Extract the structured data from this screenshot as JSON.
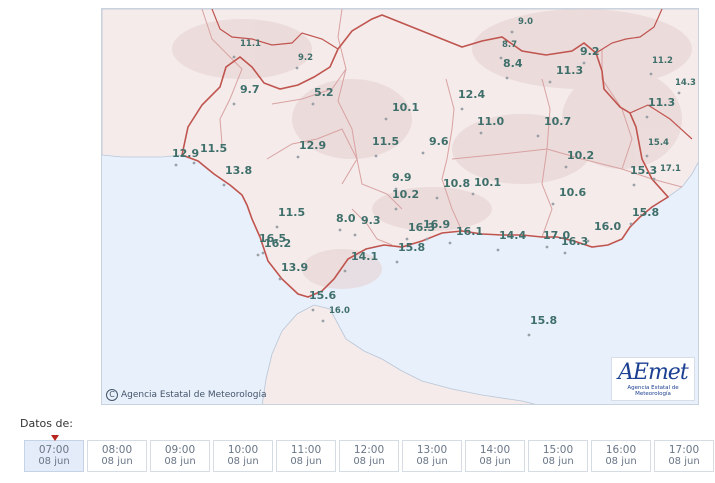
{
  "map": {
    "copyright": "Agencia Estatal de Meteorología",
    "logo_text": "AEmet",
    "logo_sub": "Agencia Estatal de Meteorología",
    "colors": {
      "sea": "#e8f0fb",
      "land": "#f4ebea",
      "relief": "#e5cfcf",
      "province_border": "#d9a2a2",
      "region_border": "#c0544e",
      "value": "#3f6f6a"
    },
    "temperatures": [
      {
        "v": "9.0"
      },
      {
        "v": "8.7"
      },
      {
        "v": "9.2"
      },
      {
        "v": "11.1"
      },
      {
        "v": "9.2"
      },
      {
        "v": "8.4"
      },
      {
        "v": "11.3"
      },
      {
        "v": "11.2"
      },
      {
        "v": "14.3"
      },
      {
        "v": "9.7"
      },
      {
        "v": "5.2"
      },
      {
        "v": "12.4"
      },
      {
        "v": "10.1"
      },
      {
        "v": "11.3"
      },
      {
        "v": "11.0"
      },
      {
        "v": "10.7"
      },
      {
        "v": "12.9"
      },
      {
        "v": "11.5"
      },
      {
        "v": "9.6"
      },
      {
        "v": "15.4"
      },
      {
        "v": "12.9"
      },
      {
        "v": "11.5"
      },
      {
        "v": "10.2"
      },
      {
        "v": "15.3"
      },
      {
        "v": "17.1"
      },
      {
        "v": "13.8"
      },
      {
        "v": "9.9"
      },
      {
        "v": "10.8"
      },
      {
        "v": "10.1"
      },
      {
        "v": "10.2"
      },
      {
        "v": "10.6"
      },
      {
        "v": "11.5"
      },
      {
        "v": "8.0"
      },
      {
        "v": "9.3"
      },
      {
        "v": "16.3"
      },
      {
        "v": "16.9"
      },
      {
        "v": "16.1"
      },
      {
        "v": "14.4"
      },
      {
        "v": "17.0"
      },
      {
        "v": "16.0"
      },
      {
        "v": "15.8"
      },
      {
        "v": "16.5"
      },
      {
        "v": "16.2"
      },
      {
        "v": "15.8"
      },
      {
        "v": "16.3"
      },
      {
        "v": "14.1"
      },
      {
        "v": "13.9"
      },
      {
        "v": "15.6"
      },
      {
        "v": "16.0"
      },
      {
        "v": "15.8"
      }
    ]
  },
  "datos_label": "Datos de:",
  "timeline": [
    {
      "time": "07:00",
      "date": "08 jun",
      "active": true
    },
    {
      "time": "08:00",
      "date": "08 jun"
    },
    {
      "time": "09:00",
      "date": "08 jun"
    },
    {
      "time": "10:00",
      "date": "08 jun"
    },
    {
      "time": "11:00",
      "date": "08 jun"
    },
    {
      "time": "12:00",
      "date": "08 jun"
    },
    {
      "time": "13:00",
      "date": "08 jun"
    },
    {
      "time": "14:00",
      "date": "08 jun"
    },
    {
      "time": "15:00",
      "date": "08 jun"
    },
    {
      "time": "16:00",
      "date": "08 jun"
    },
    {
      "time": "17:00",
      "date": "08 jun"
    }
  ]
}
